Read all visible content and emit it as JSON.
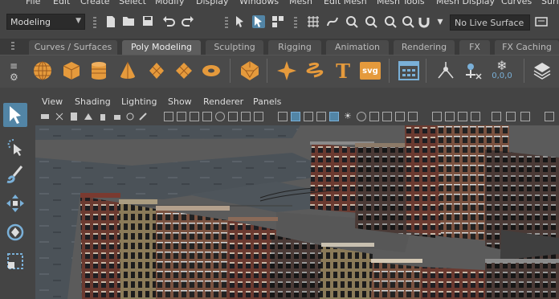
{
  "menubar": {
    "items": [
      "File",
      "Edit",
      "Create",
      "Select",
      "Modify",
      "Display",
      "Windows",
      "Mesh",
      "Edit Mesh",
      "Mesh Tools",
      "Mesh Display",
      "Curves",
      "Surf"
    ]
  },
  "status_line": {
    "mode": "Modeling",
    "live_surface": "No Live Surface"
  },
  "shelf": {
    "tabs": [
      "Curves / Surfaces",
      "Poly Modeling",
      "Sculpting",
      "Rigging",
      "Animation",
      "Rendering",
      "FX",
      "FX Caching"
    ],
    "active_tab": "Poly Modeling",
    "svg_label": "svg",
    "text_label": "T",
    "counter_label": "0,0,0"
  },
  "viewport": {
    "menus": [
      "View",
      "Shading",
      "Lighting",
      "Show",
      "Renderer",
      "Panels"
    ]
  },
  "colors": {
    "accent_orange": "#e59a3c",
    "selection_blue": "#5285a6"
  }
}
